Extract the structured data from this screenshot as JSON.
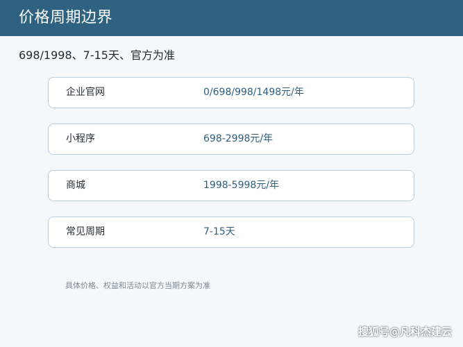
{
  "header": {
    "title": "价格周期边界"
  },
  "subtitle": "698/1998、7-15天、官方为准",
  "rows": [
    {
      "label": "企业官网",
      "value": "0/698/998/1498元/年"
    },
    {
      "label": "小程序",
      "value": "698-2998元/年"
    },
    {
      "label": "商城",
      "value": "1998-5998元/年"
    },
    {
      "label": "常见周期",
      "value": "7-15天"
    }
  ],
  "note": "具体价格、权益和活动以官方当期方案为准",
  "watermark": "搜狐号@凡科杰建云",
  "colors": {
    "header_bg": "#2e6280",
    "page_bg": "#f4f8fb",
    "value_text": "#2e5e7e",
    "row_border": "#b9cfe0"
  }
}
